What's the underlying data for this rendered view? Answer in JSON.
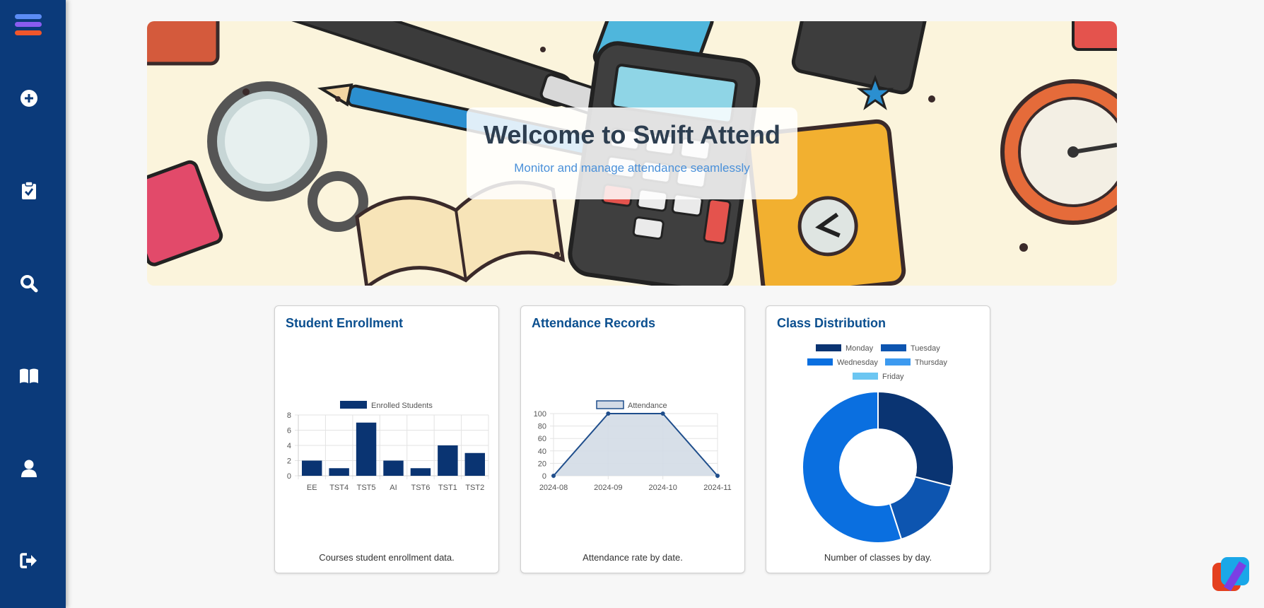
{
  "sidebar": {
    "items": [
      {
        "name": "menu-icon"
      },
      {
        "name": "add-icon"
      },
      {
        "name": "clipboard-check-icon"
      },
      {
        "name": "search-icon"
      },
      {
        "name": "book-icon"
      },
      {
        "name": "user-icon"
      },
      {
        "name": "logout-icon"
      }
    ]
  },
  "banner": {
    "title": "Welcome to Swift Attend",
    "subtitle": "Monitor and manage attendance seamlessly"
  },
  "cards": {
    "enrollment": {
      "title": "Student Enrollment",
      "caption": "Courses student enrollment data."
    },
    "attendance": {
      "title": "Attendance Records",
      "caption": "Attendance rate by date."
    },
    "distribution": {
      "title": "Class Distribution",
      "caption": "Number of classes by day."
    }
  },
  "colors": {
    "sidebar": "#0b3a7a",
    "primary_dark": "#0a3472",
    "title_blue": "#0b4f8f"
  },
  "chart_data": [
    {
      "type": "bar",
      "title": "",
      "categories": [
        "EE",
        "TST4",
        "TST5",
        "AI",
        "TST6",
        "TST1",
        "TST2"
      ],
      "series": [
        {
          "name": "Enrolled Students",
          "values": [
            2,
            1,
            7,
            2,
            1,
            4,
            3
          ],
          "color": "#0a3472"
        }
      ],
      "yticks": [
        0,
        2,
        4,
        6,
        8
      ],
      "ylim": [
        0,
        8
      ],
      "legend": "top"
    },
    {
      "type": "area",
      "title": "",
      "x": [
        "2024-08",
        "2024-09",
        "2024-10",
        "2024-11"
      ],
      "series": [
        {
          "name": "Attendance",
          "values": [
            0,
            100,
            100,
            0
          ],
          "color": "#1f4e8c",
          "fill": "#d3dbe6"
        }
      ],
      "yticks": [
        0,
        20,
        40,
        60,
        80,
        100
      ],
      "ylim": [
        0,
        100
      ],
      "legend": "top"
    },
    {
      "type": "pie",
      "variant": "doughnut",
      "title": "",
      "categories": [
        "Monday",
        "Tuesday",
        "Wednesday",
        "Thursday",
        "Friday"
      ],
      "values": [
        29,
        16,
        55,
        0,
        0
      ],
      "colors": [
        "#0a3472",
        "#0d55b0",
        "#0a6fe0",
        "#3c9af0",
        "#6cc6f2"
      ],
      "legend": "top"
    }
  ]
}
